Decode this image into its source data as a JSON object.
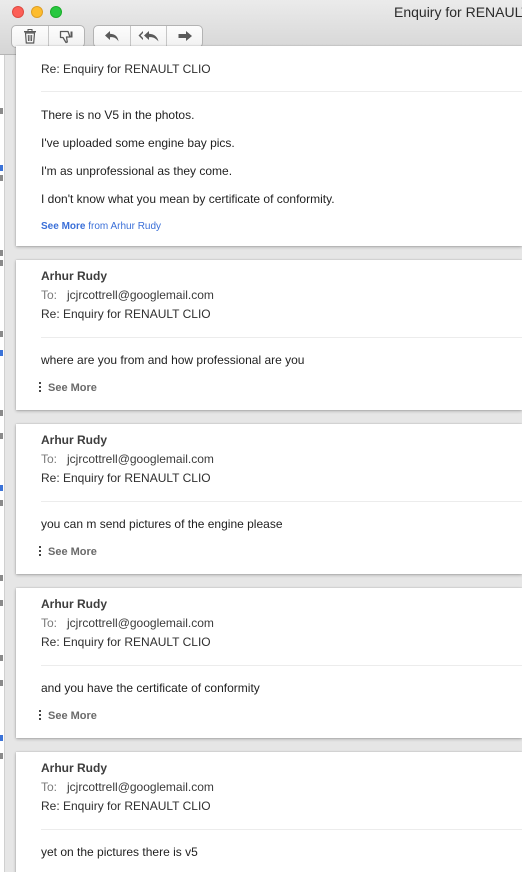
{
  "window": {
    "title": "Enquiry for RENAULT",
    "accent": "#3a6fd8"
  },
  "toolbar": {
    "delete_icon": "trash-icon",
    "junk_icon": "thumbs-down-icon",
    "reply_icon": "reply-icon",
    "reply_all_icon": "reply-all-icon",
    "forward_icon": "forward-icon"
  },
  "first_message": {
    "subject": "Re: Enquiry for RENAULT CLIO",
    "lines": [
      "There is no V5 in the photos.",
      "I've uploaded some engine bay pics.",
      "I'm as unprofessional as they come.",
      "I don't know what you mean by certificate of conformity."
    ],
    "see_more": "See More",
    "see_more_from": "from Arhur Rudy"
  },
  "messages": [
    {
      "sender": "Arhur Rudy",
      "to_label": "To:",
      "to": "jcjrcottrell@googlemail.com",
      "subject": "Re: Enquiry for RENAULT CLIO",
      "body": "where are you from and how professional are you",
      "see_more": "See More"
    },
    {
      "sender": "Arhur Rudy",
      "to_label": "To:",
      "to": "jcjrcottrell@googlemail.com",
      "subject": "Re: Enquiry for RENAULT CLIO",
      "body": "you can m send pictures of the engine please",
      "see_more": "See More"
    },
    {
      "sender": "Arhur Rudy",
      "to_label": "To:",
      "to": "jcjrcottrell@googlemail.com",
      "subject": "Re: Enquiry for RENAULT CLIO",
      "body": "and you have the certificate of conformity",
      "see_more": "See More"
    },
    {
      "sender": "Arhur Rudy",
      "to_label": "To:",
      "to": "jcjrcottrell@googlemail.com",
      "subject": "Re: Enquiry for RENAULT CLIO",
      "body": "yet on the pictures there is v5"
    }
  ]
}
